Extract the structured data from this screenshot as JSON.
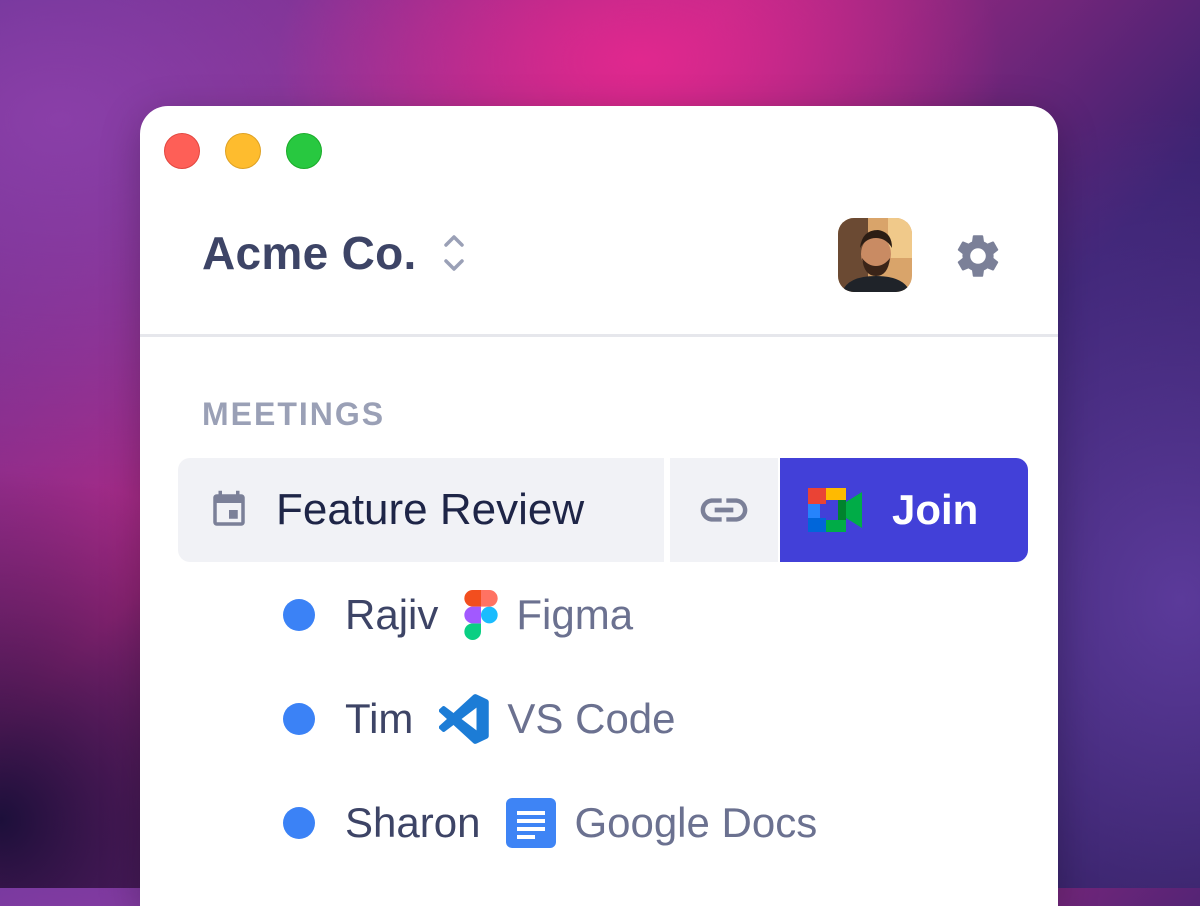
{
  "window": {
    "controls": [
      "close",
      "minimize",
      "zoom"
    ]
  },
  "header": {
    "workspace_name": "Acme Co.",
    "switcher_icon": "chevron-up-down-icon",
    "avatar_icon": "user-avatar",
    "settings_icon": "gear-icon"
  },
  "meetings": {
    "section_title": "MEETINGS",
    "current": {
      "title": "Feature Review",
      "calendar_icon": "calendar-icon",
      "link_icon": "link-icon",
      "join_label": "Join",
      "join_icon": "google-meet-icon"
    },
    "participants": [
      {
        "name": "Rajiv",
        "app": "Figma",
        "app_icon": "figma-icon",
        "status_color": "#3b82f6"
      },
      {
        "name": "Tim",
        "app": "VS Code",
        "app_icon": "vscode-icon",
        "status_color": "#3b82f6"
      },
      {
        "name": "Sharon",
        "app": "Google Docs",
        "app_icon": "google-docs-icon",
        "status_color": "#3b82f6"
      }
    ]
  },
  "colors": {
    "accent": "#4240d8",
    "status_dot": "#3b82f6",
    "text_primary": "#3d4466"
  }
}
